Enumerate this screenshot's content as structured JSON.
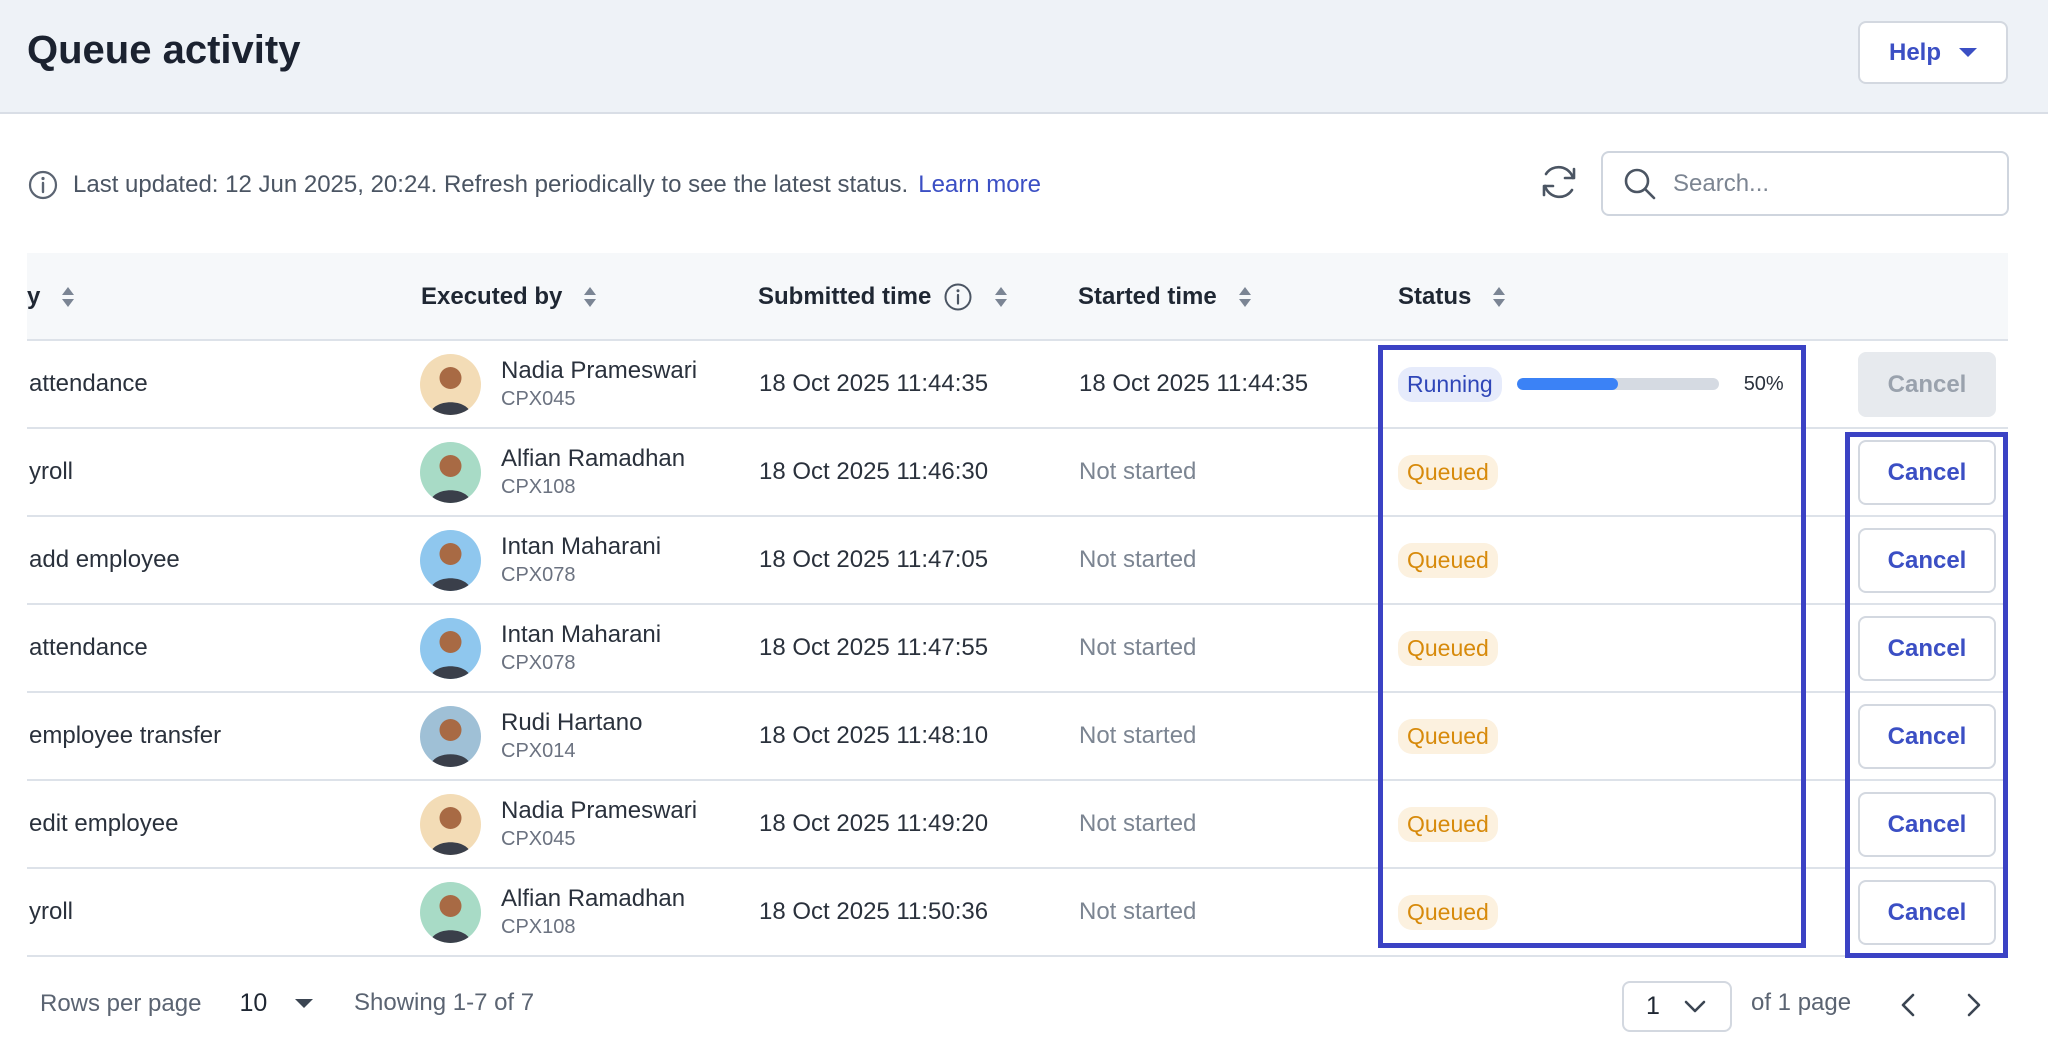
{
  "header": {
    "title": "Queue activity",
    "help_label": "Help"
  },
  "info": {
    "text": "Last updated: 12 Jun 2025, 20:24. Refresh periodically to see the latest status.",
    "link": "Learn more"
  },
  "search": {
    "placeholder": "Search..."
  },
  "columns": {
    "col1": "y",
    "executed_by": "Executed by",
    "submitted_time": "Submitted time",
    "started_time": "Started time",
    "status": "Status"
  },
  "rows": [
    {
      "job": "attendance",
      "name": "Nadia Prameswari",
      "code": "CPX045",
      "submitted": "18 Oct 2025 11:44:35",
      "started": "18 Oct 2025 11:44:35",
      "status": "Running",
      "progress": 0.5,
      "progress_label": "50%",
      "cancel": "Cancel",
      "cancel_enabled": false,
      "avatar_bg": "#f3dcb6"
    },
    {
      "job": "yroll",
      "name": "Alfian Ramadhan",
      "code": "CPX108",
      "submitted": "18 Oct 2025 11:46:30",
      "started": "Not started",
      "status": "Queued",
      "cancel": "Cancel",
      "cancel_enabled": true,
      "avatar_bg": "#a8dbc6"
    },
    {
      "job": "add employee",
      "name": "Intan Maharani",
      "code": "CPX078",
      "submitted": "18 Oct 2025 11:47:05",
      "started": "Not started",
      "status": "Queued",
      "cancel": "Cancel",
      "cancel_enabled": true,
      "avatar_bg": "#8fc7ee"
    },
    {
      "job": "attendance",
      "name": "Intan Maharani",
      "code": "CPX078",
      "submitted": "18 Oct 2025 11:47:55",
      "started": "Not started",
      "status": "Queued",
      "cancel": "Cancel",
      "cancel_enabled": true,
      "avatar_bg": "#8fc7ee"
    },
    {
      "job": "employee transfer",
      "name": "Rudi Hartano",
      "code": "CPX014",
      "submitted": "18 Oct 2025 11:48:10",
      "started": "Not started",
      "status": "Queued",
      "cancel": "Cancel",
      "cancel_enabled": true,
      "avatar_bg": "#9fc0d6"
    },
    {
      "job": "edit employee",
      "name": "Nadia Prameswari",
      "code": "CPX045",
      "submitted": "18 Oct 2025 11:49:20",
      "started": "Not started",
      "status": "Queued",
      "cancel": "Cancel",
      "cancel_enabled": true,
      "avatar_bg": "#f3dcb6"
    },
    {
      "job": "yroll",
      "name": "Alfian Ramadhan",
      "code": "CPX108",
      "submitted": "18 Oct 2025 11:50:36",
      "started": "Not started",
      "status": "Queued",
      "cancel": "Cancel",
      "cancel_enabled": true,
      "avatar_bg": "#a8dbc6"
    }
  ],
  "footer": {
    "rows_label": "Rows per page",
    "rows_value": "10",
    "showing": "Showing 1-7 of 7",
    "page_value": "1",
    "page_of": "of 1 page"
  },
  "colors": {
    "accent": "#3b4fc4",
    "highlight": "#3b42c4",
    "running_bg": "#e6ebfb",
    "queued_bg": "#fcf1df",
    "queued_text": "#d78a0b",
    "progress": "#3b82f6"
  }
}
